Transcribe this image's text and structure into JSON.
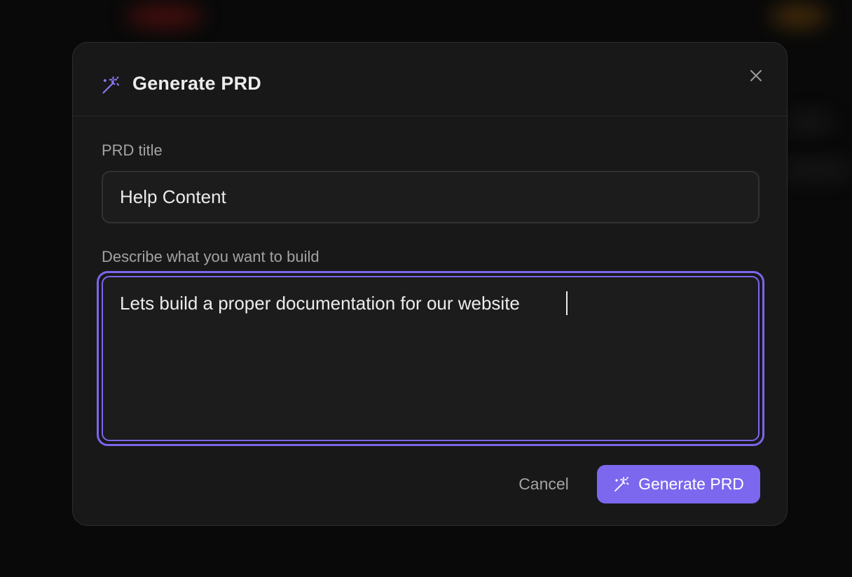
{
  "modal": {
    "title": "Generate PRD",
    "title_icon": "magic-wand-icon",
    "close_icon": "close-icon",
    "accent_color": "#7b68ee"
  },
  "form": {
    "title_label": "PRD title",
    "title_value": "Help Content",
    "description_label": "Describe what you want to build",
    "description_value": "Lets build a proper documentation for our website"
  },
  "actions": {
    "cancel_label": "Cancel",
    "generate_label": "Generate PRD",
    "generate_icon": "magic-wand-icon"
  }
}
